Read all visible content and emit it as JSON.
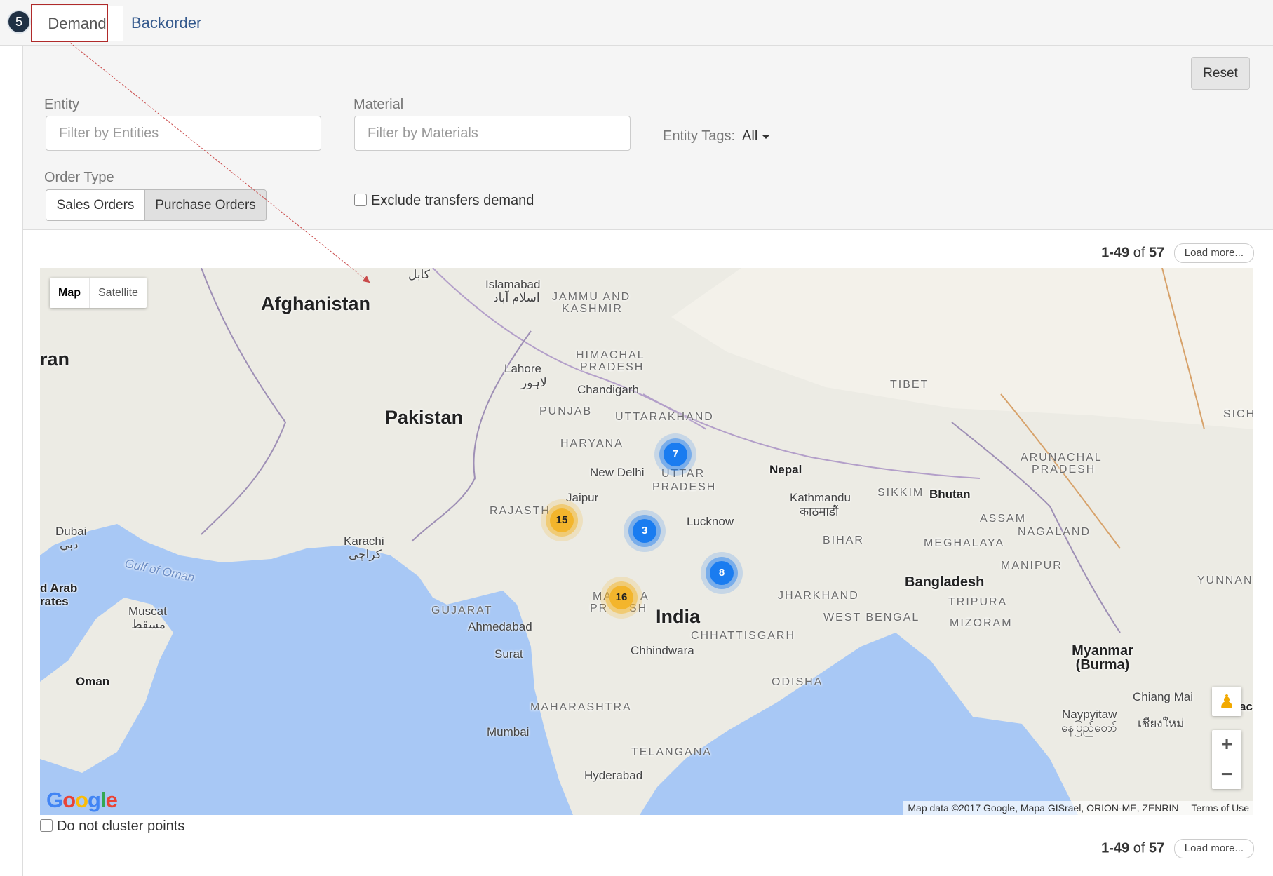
{
  "tabs": {
    "demand": "Demand",
    "backorder": "Backorder"
  },
  "annotation": {
    "step": "5"
  },
  "filters": {
    "reset_label": "Reset",
    "entity_label": "Entity",
    "entity_placeholder": "Filter by Entities",
    "material_label": "Material",
    "material_placeholder": "Filter by Materials",
    "entity_tags_label": "Entity Tags:",
    "entity_tags_value": "All",
    "order_type_label": "Order Type",
    "order_types": [
      "Sales Orders",
      "Purchase Orders"
    ],
    "exclude_transfers_label": "Exclude transfers demand"
  },
  "pagination": {
    "range": "1-49",
    "of": "of",
    "total": "57",
    "load_more": "Load more..."
  },
  "map": {
    "type_controls": [
      "Map",
      "Satellite"
    ],
    "countries": [
      "Afghanistan",
      "Pakistan",
      "India",
      "Nepal",
      "Bhutan",
      "Bangladesh",
      "Myanmar (Burma)",
      "Oman",
      "ran",
      "d Arab",
      "rates",
      "TIBET",
      "SICH",
      "YUNNAN"
    ],
    "states": [
      "JAMMU AND",
      "KASHMIR",
      "HIMACHAL",
      "PRADESH",
      "PUNJAB",
      "UTTARAKHAND",
      "HARYANA",
      "UTTAR",
      "PRADESH",
      "RAJASTH",
      "GUJARAT",
      "MA",
      "PR",
      "A",
      "SH",
      "CHHATTISGARH",
      "JHARKHAND",
      "WEST BENGAL",
      "BIHAR",
      "ODISHA",
      "MAHARASHTRA",
      "TELANGANA",
      "SIKKIM",
      "ARUNACHAL",
      "PRADESH",
      "ASSAM",
      "NAGALAND",
      "MEGHALAYA",
      "MANIPUR",
      "TRIPURA",
      "MIZORAM"
    ],
    "cities": [
      "کابل",
      "Islamabad",
      "اسلام آباد",
      "Lahore",
      "لاہور",
      "Chandigarh",
      "New Delhi",
      "Jaipur",
      "Lucknow",
      "Kathmandu",
      "काठमाडौं",
      "Karachi",
      "کراچی",
      "Dubai",
      "دبي",
      "Muscat",
      "مسقط",
      "Ahmedabad",
      "Surat",
      "Chhindwara",
      "Mumbai",
      "Hyderabad",
      "Naypyitaw",
      "နေပြည်တော်",
      "Chiang Mai",
      "เชียงใหม่",
      "ac"
    ],
    "water": "Gulf of Oman",
    "clusters": [
      {
        "count": "7",
        "color": "#1a7cf0"
      },
      {
        "count": "15",
        "color": "#f3b52c"
      },
      {
        "count": "3",
        "color": "#1a7cf0"
      },
      {
        "count": "8",
        "color": "#1a7cf0"
      },
      {
        "count": "16",
        "color": "#f3b52c"
      }
    ],
    "zoom_in": "+",
    "zoom_out": "−",
    "pegman_icon": "person-icon",
    "logo": "Google",
    "attribution": "Map data ©2017 Google, Mapa GISrael, ORION-ME, ZENRIN",
    "terms": "Terms of Use"
  },
  "cluster_toggle_label": "Do not cluster points",
  "colors": {
    "link": "#34598d",
    "annotation": "#b02a2a",
    "cluster_blue": "#1a7cf0",
    "cluster_yellow": "#f3b52c",
    "sea": "#a8c8f5",
    "land": "#ecebe4"
  }
}
